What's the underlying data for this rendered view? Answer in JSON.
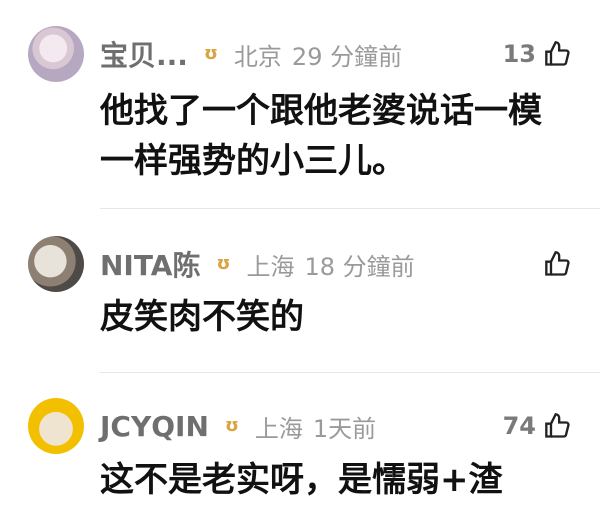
{
  "comments": [
    {
      "user": "宝贝...",
      "location": "北京",
      "time": "29 分鐘前",
      "likes": "13",
      "text_lines": [
        "他找了一个跟他老婆说话一模",
        "一样强势的小三儿。"
      ]
    },
    {
      "user": "NITA陈",
      "location": "上海",
      "time": "18 分鐘前",
      "likes": "",
      "text_lines": [
        "皮笑肉不笑的"
      ]
    },
    {
      "user": "JCYQIN",
      "location": "上海",
      "time": "1天前",
      "likes": "74",
      "text_lines": [
        "这不是老实呀，是懦弱+渣"
      ]
    }
  ]
}
